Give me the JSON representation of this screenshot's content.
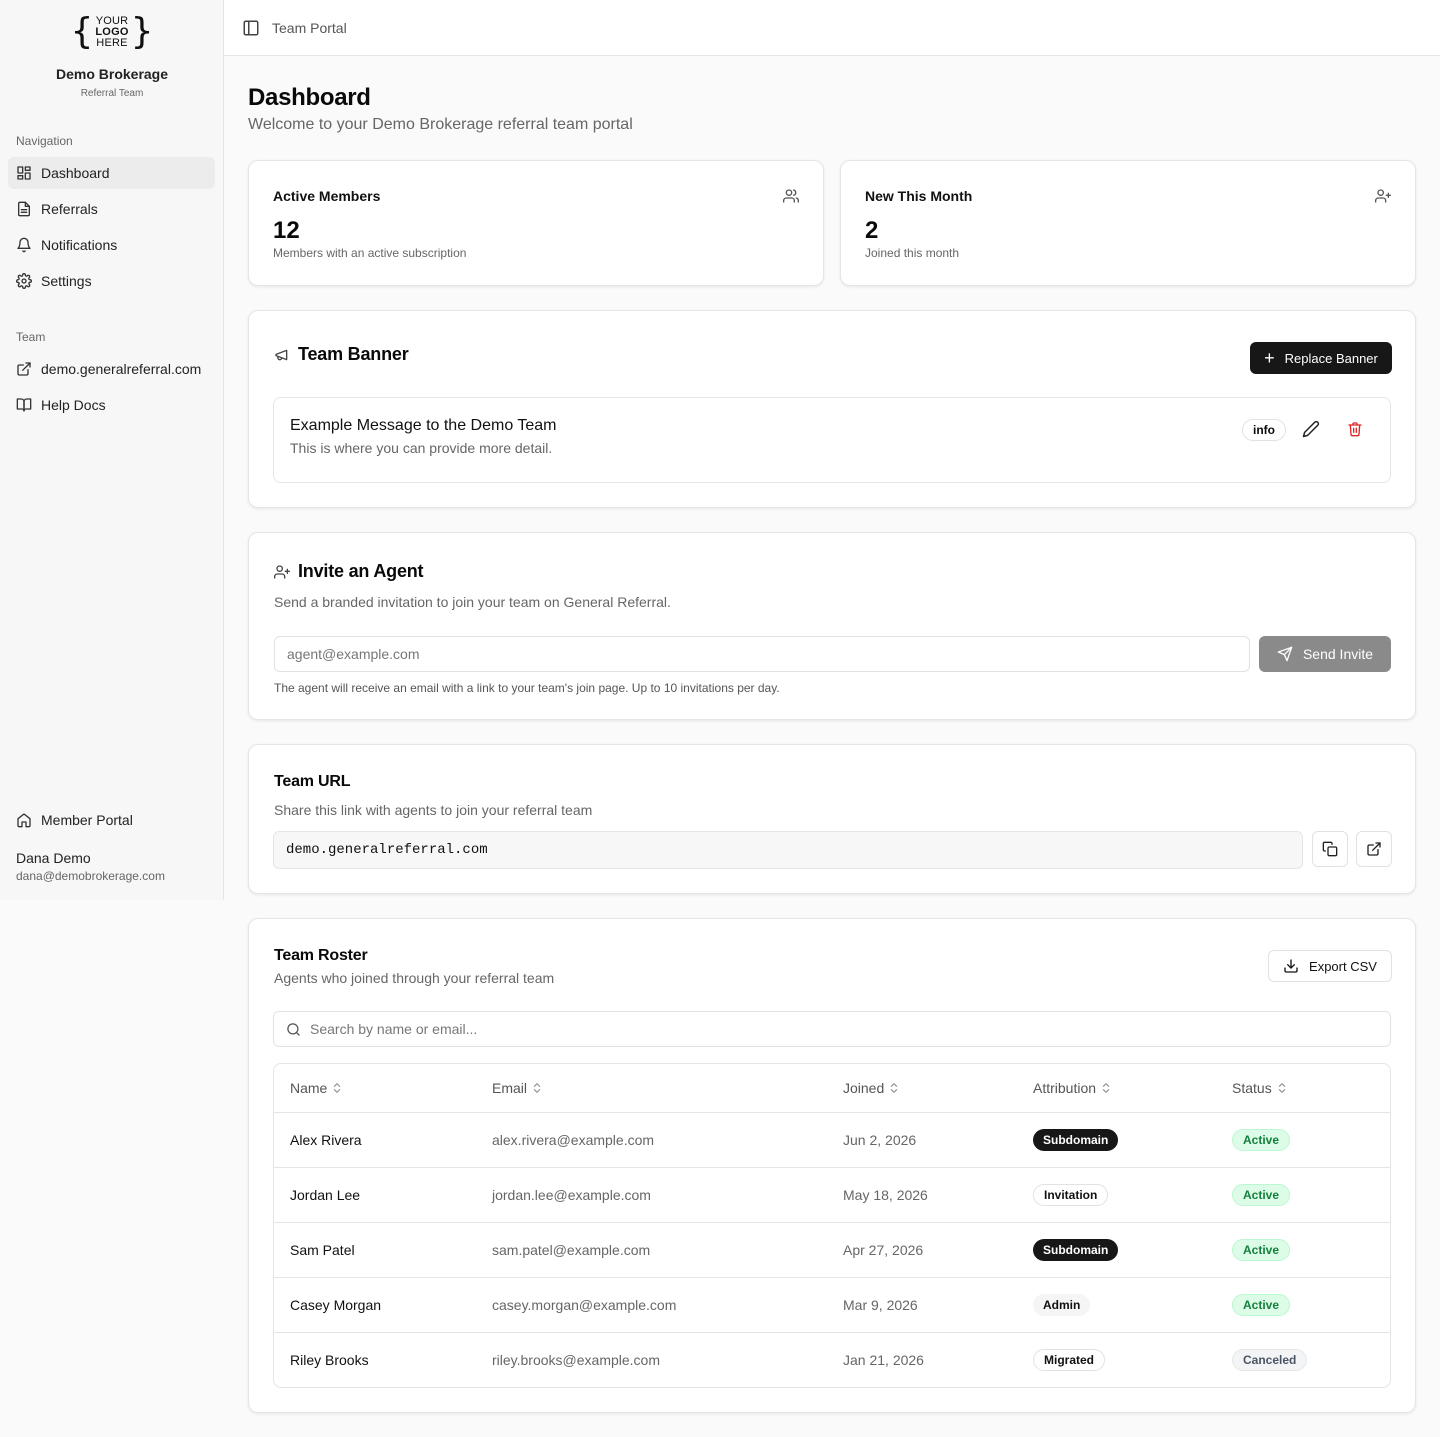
{
  "sidebar": {
    "logo": {
      "line1": "YOUR",
      "line2": "LOGO",
      "line3": "HERE"
    },
    "brand_name": "Demo Brokerage",
    "brand_sub": "Referral Team",
    "nav_label": "Navigation",
    "nav_items": [
      {
        "label": "Dashboard",
        "icon": "dashboard-icon"
      },
      {
        "label": "Referrals",
        "icon": "file-text-icon"
      },
      {
        "label": "Notifications",
        "icon": "bell-icon"
      },
      {
        "label": "Settings",
        "icon": "gear-icon"
      }
    ],
    "team_label": "Team",
    "team_items": [
      {
        "label": "demo.generalreferral.com",
        "icon": "external-link-icon"
      },
      {
        "label": "Help Docs",
        "icon": "book-icon"
      }
    ],
    "member_portal": "Member Portal",
    "user": {
      "name": "Dana Demo",
      "email": "dana@demobrokerage.com"
    }
  },
  "topbar": {
    "breadcrumb": "Team Portal"
  },
  "page": {
    "title": "Dashboard",
    "subtitle": "Welcome to your Demo Brokerage referral team portal"
  },
  "stats": [
    {
      "label": "Active Members",
      "value": "12",
      "desc": "Members with an active subscription",
      "icon": "users-icon"
    },
    {
      "label": "New This Month",
      "value": "2",
      "desc": "Joined this month",
      "icon": "user-plus-icon"
    }
  ],
  "banner": {
    "title": "Team Banner",
    "replace_label": "Replace Banner",
    "message_title": "Example Message to the Demo Team",
    "message_text": "This is where you can provide more detail.",
    "level": "info"
  },
  "invite": {
    "title": "Invite an Agent",
    "subtitle": "Send a branded invitation to join your team on General Referral.",
    "placeholder": "agent@example.com",
    "button": "Send Invite",
    "hint": "The agent will receive an email with a link to your team's join page. Up to 10 invitations per day."
  },
  "team_url": {
    "title": "Team URL",
    "subtitle": "Share this link with agents to join your referral team",
    "url": "demo.generalreferral.com"
  },
  "roster": {
    "title": "Team Roster",
    "subtitle": "Agents who joined through your referral team",
    "export_label": "Export CSV",
    "search_placeholder": "Search by name or email...",
    "columns": [
      "Name",
      "Email",
      "Joined",
      "Attribution",
      "Status"
    ],
    "rows": [
      {
        "name": "Alex Rivera",
        "email": "alex.rivera@example.com",
        "joined": "Jun 2, 2026",
        "attribution": "Subdomain",
        "status": "Active"
      },
      {
        "name": "Jordan Lee",
        "email": "jordan.lee@example.com",
        "joined": "May 18, 2026",
        "attribution": "Invitation",
        "status": "Active"
      },
      {
        "name": "Sam Patel",
        "email": "sam.patel@example.com",
        "joined": "Apr 27, 2026",
        "attribution": "Subdomain",
        "status": "Active"
      },
      {
        "name": "Casey Morgan",
        "email": "casey.morgan@example.com",
        "joined": "Mar 9, 2026",
        "attribution": "Admin",
        "status": "Active"
      },
      {
        "name": "Riley Brooks",
        "email": "riley.brooks@example.com",
        "joined": "Jan 21, 2026",
        "attribution": "Migrated",
        "status": "Canceled"
      }
    ]
  },
  "colors": {
    "primary": "#171717",
    "danger": "#dc2626",
    "active_bg": "#dcfce7",
    "active_text": "#15803d",
    "muted_text": "#666666"
  }
}
